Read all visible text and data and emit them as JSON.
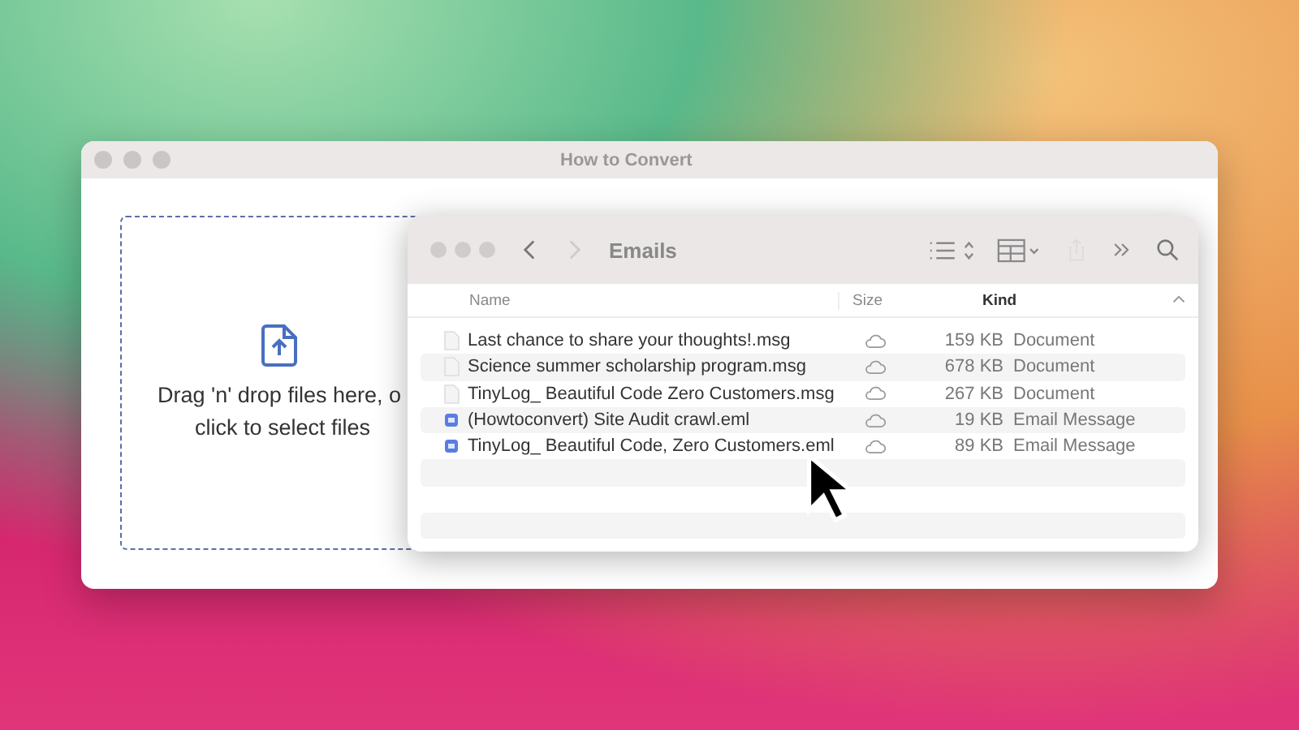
{
  "window": {
    "title": "How to Convert"
  },
  "dropzone": {
    "text": "Drag 'n' drop files here, o",
    "text_2": "click to select files"
  },
  "finder": {
    "title": "Emails",
    "columns": [
      {
        "label": "Name",
        "sorted": false
      },
      {
        "label": "Size",
        "sorted": false
      },
      {
        "label": "Kind",
        "sorted": true
      }
    ],
    "rows": [
      {
        "name": "Last chance to share your thoughts!.msg",
        "size": "159 KB",
        "type": "Document",
        "kind": "document"
      },
      {
        "name": "Science summer scholarship program.msg",
        "size": "678 KB",
        "type": "Document",
        "kind": "document"
      },
      {
        "name": "TinyLog_ Beautiful Code Zero Customers.msg",
        "size": "267 KB",
        "type": "Document",
        "kind": "document"
      },
      {
        "name": "(Howtoconvert) Site Audit crawl.eml",
        "size": "19 KB",
        "type": "Email Message",
        "kind": "email"
      },
      {
        "name": "TinyLog_ Beautiful Code, Zero Customers.eml",
        "size": "89 KB",
        "type": "Email Message",
        "kind": "email"
      }
    ]
  }
}
